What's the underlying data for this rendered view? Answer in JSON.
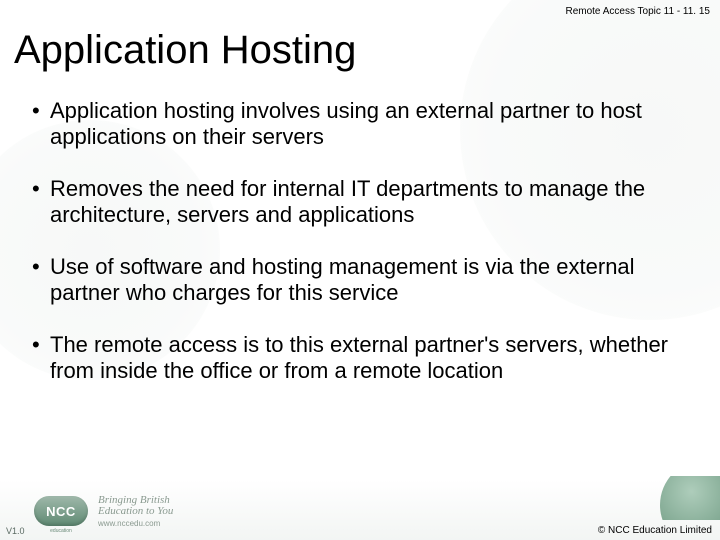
{
  "header": {
    "meta": "Remote Access  Topic 11 - 11. 15"
  },
  "title": "Application Hosting",
  "bullets": [
    "Application hosting involves using an external partner to host applications on their servers",
    "Removes the need for internal IT departments to manage the architecture, servers and applications",
    "Use of software and hosting management is via the external partner who charges for this service",
    "The remote access is to this external partner's servers, whether from inside the office or from a remote location"
  ],
  "footer": {
    "version": "V1.0",
    "copyright": "©  NCC Education Limited",
    "logo_text": "NCC",
    "logo_sub": "education",
    "tagline_line1": "Bringing British",
    "tagline_line2": "Education to You",
    "url": "www.nccedu.com"
  }
}
